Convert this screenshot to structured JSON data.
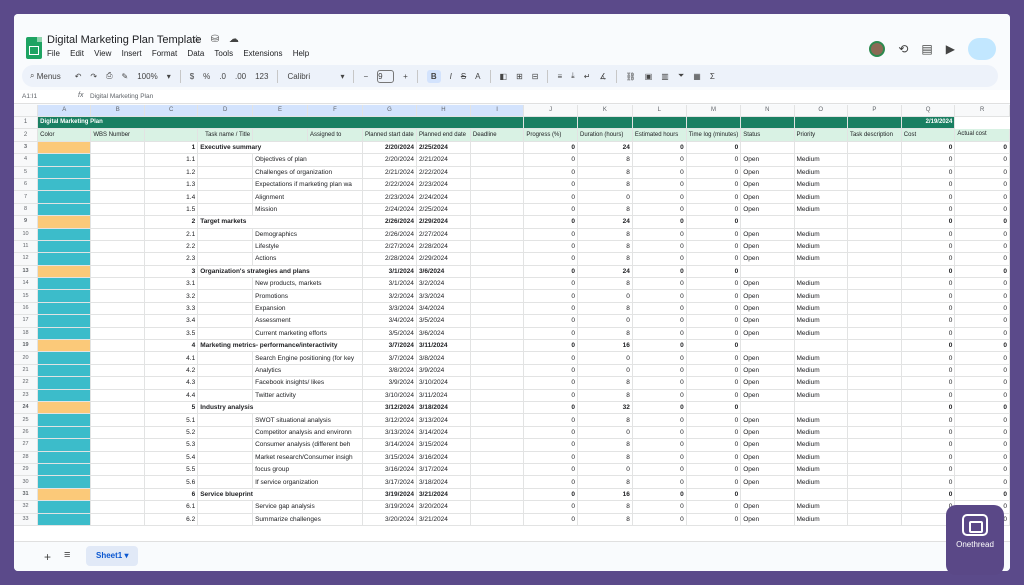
{
  "app": {
    "doc_title": "Digital Marketing Plan Template",
    "menu": [
      "File",
      "Edit",
      "View",
      "Insert",
      "Format",
      "Data",
      "Tools",
      "Extensions",
      "Help"
    ]
  },
  "toolbar": {
    "menus_label": "Menus",
    "zoom": "100%",
    "currency": "$",
    "percent": "%",
    "decrease_decimal": ".0",
    "increase_decimal": ".00",
    "number_format": "123",
    "font": "Calibri",
    "font_size": "9",
    "bold": "B",
    "italic": "I",
    "strike": "S",
    "text_color": "A"
  },
  "formula_bar": {
    "cell": "A1:I1",
    "fx": "fx",
    "content": "Digital Marketing Plan"
  },
  "columns": [
    "A",
    "B",
    "C",
    "D",
    "E",
    "F",
    "G",
    "H",
    "I",
    "J",
    "K",
    "L",
    "M",
    "N",
    "O",
    "P",
    "Q",
    "R"
  ],
  "title_row": {
    "text": "Digital Marketing Plan",
    "date": "2/19/2024"
  },
  "headers": [
    "Color",
    "WBS Number",
    "",
    "Task name / Title",
    "",
    "Assigned to",
    "Planned start date",
    "Planned end date",
    "Deadline",
    "Progress (%)",
    "Duration (hours)",
    "Estimated hours",
    "Time log (minutes)",
    "Status",
    "Priority",
    "Task description",
    "Cost",
    "Actual cost"
  ],
  "rows": [
    {
      "n": "3",
      "color": "orange",
      "section": true,
      "wbs": "1",
      "task": "Executive summary",
      "start": "2/20/2024",
      "end": "2/25/2024",
      "progress": "0",
      "duration": "24",
      "est": "0",
      "time": "0",
      "status": "",
      "priority": "",
      "cost": "0",
      "actual": "0"
    },
    {
      "n": "4",
      "color": "teal",
      "wbs": "1.1",
      "task": "Objectives of plan",
      "start": "2/20/2024",
      "end": "2/21/2024",
      "progress": "0",
      "duration": "8",
      "est": "0",
      "time": "0",
      "status": "Open",
      "priority": "Medium",
      "cost": "0",
      "actual": "0"
    },
    {
      "n": "5",
      "color": "teal",
      "wbs": "1.2",
      "task": "Challenges of organization",
      "start": "2/21/2024",
      "end": "2/22/2024",
      "progress": "0",
      "duration": "8",
      "est": "0",
      "time": "0",
      "status": "Open",
      "priority": "Medium",
      "cost": "0",
      "actual": "0"
    },
    {
      "n": "6",
      "color": "teal",
      "wbs": "1.3",
      "task": "Expectations if marketing plan wa",
      "start": "2/22/2024",
      "end": "2/23/2024",
      "progress": "0",
      "duration": "8",
      "est": "0",
      "time": "0",
      "status": "Open",
      "priority": "Medium",
      "cost": "0",
      "actual": "0"
    },
    {
      "n": "7",
      "color": "teal",
      "wbs": "1.4",
      "task": "Alignment",
      "start": "2/23/2024",
      "end": "2/24/2024",
      "progress": "0",
      "duration": "0",
      "est": "0",
      "time": "0",
      "status": "Open",
      "priority": "Medium",
      "cost": "0",
      "actual": "0"
    },
    {
      "n": "8",
      "color": "teal",
      "wbs": "1.5",
      "task": "Mission",
      "start": "2/24/2024",
      "end": "2/25/2024",
      "progress": "0",
      "duration": "8",
      "est": "0",
      "time": "0",
      "status": "Open",
      "priority": "Medium",
      "cost": "0",
      "actual": "0"
    },
    {
      "n": "9",
      "color": "orange",
      "section": true,
      "wbs": "2",
      "task": "Target markets",
      "start": "2/26/2024",
      "end": "2/29/2024",
      "progress": "0",
      "duration": "24",
      "est": "0",
      "time": "0",
      "status": "",
      "priority": "",
      "cost": "0",
      "actual": "0"
    },
    {
      "n": "10",
      "color": "teal",
      "wbs": "2.1",
      "task": "Demographics",
      "start": "2/26/2024",
      "end": "2/27/2024",
      "progress": "0",
      "duration": "8",
      "est": "0",
      "time": "0",
      "status": "Open",
      "priority": "Medium",
      "cost": "0",
      "actual": "0"
    },
    {
      "n": "11",
      "color": "teal",
      "wbs": "2.2",
      "task": "Lifestyle",
      "start": "2/27/2024",
      "end": "2/28/2024",
      "progress": "0",
      "duration": "8",
      "est": "0",
      "time": "0",
      "status": "Open",
      "priority": "Medium",
      "cost": "0",
      "actual": "0"
    },
    {
      "n": "12",
      "color": "teal",
      "wbs": "2.3",
      "task": "Actions",
      "start": "2/28/2024",
      "end": "2/29/2024",
      "progress": "0",
      "duration": "8",
      "est": "0",
      "time": "0",
      "status": "Open",
      "priority": "Medium",
      "cost": "0",
      "actual": "0"
    },
    {
      "n": "13",
      "color": "orange",
      "section": true,
      "wbs": "3",
      "task": "Organization's strategies and plans",
      "start": "3/1/2024",
      "end": "3/6/2024",
      "progress": "0",
      "duration": "24",
      "est": "0",
      "time": "0",
      "status": "",
      "priority": "",
      "cost": "0",
      "actual": "0"
    },
    {
      "n": "14",
      "color": "teal",
      "wbs": "3.1",
      "task": "New products, markets",
      "start": "3/1/2024",
      "end": "3/2/2024",
      "progress": "0",
      "duration": "8",
      "est": "0",
      "time": "0",
      "status": "Open",
      "priority": "Medium",
      "cost": "0",
      "actual": "0"
    },
    {
      "n": "15",
      "color": "teal",
      "wbs": "3.2",
      "task": "Promotions",
      "start": "3/2/2024",
      "end": "3/3/2024",
      "progress": "0",
      "duration": "0",
      "est": "0",
      "time": "0",
      "status": "Open",
      "priority": "Medium",
      "cost": "0",
      "actual": "0"
    },
    {
      "n": "16",
      "color": "teal",
      "wbs": "3.3",
      "task": "Expansion",
      "start": "3/3/2024",
      "end": "3/4/2024",
      "progress": "0",
      "duration": "8",
      "est": "0",
      "time": "0",
      "status": "Open",
      "priority": "Medium",
      "cost": "0",
      "actual": "0"
    },
    {
      "n": "17",
      "color": "teal",
      "wbs": "3.4",
      "task": "Assessment",
      "start": "3/4/2024",
      "end": "3/5/2024",
      "progress": "0",
      "duration": "0",
      "est": "0",
      "time": "0",
      "status": "Open",
      "priority": "Medium",
      "cost": "0",
      "actual": "0"
    },
    {
      "n": "18",
      "color": "teal",
      "wbs": "3.5",
      "task": "Current marketing efforts",
      "start": "3/5/2024",
      "end": "3/6/2024",
      "progress": "0",
      "duration": "8",
      "est": "0",
      "time": "0",
      "status": "Open",
      "priority": "Medium",
      "cost": "0",
      "actual": "0"
    },
    {
      "n": "19",
      "color": "orange",
      "section": true,
      "wbs": "4",
      "task": "Marketing metrics- performance/interactivity",
      "start": "3/7/2024",
      "end": "3/11/2024",
      "progress": "0",
      "duration": "16",
      "est": "0",
      "time": "0",
      "status": "",
      "priority": "",
      "cost": "0",
      "actual": "0"
    },
    {
      "n": "20",
      "color": "teal",
      "wbs": "4.1",
      "task": "Search Engine positioning (for key",
      "start": "3/7/2024",
      "end": "3/8/2024",
      "progress": "0",
      "duration": "0",
      "est": "0",
      "time": "0",
      "status": "Open",
      "priority": "Medium",
      "cost": "0",
      "actual": "0"
    },
    {
      "n": "21",
      "color": "teal",
      "wbs": "4.2",
      "task": "Analytics",
      "start": "3/8/2024",
      "end": "3/9/2024",
      "progress": "0",
      "duration": "0",
      "est": "0",
      "time": "0",
      "status": "Open",
      "priority": "Medium",
      "cost": "0",
      "actual": "0"
    },
    {
      "n": "22",
      "color": "teal",
      "wbs": "4.3",
      "task": "Facebook insights/ likes",
      "start": "3/9/2024",
      "end": "3/10/2024",
      "progress": "0",
      "duration": "8",
      "est": "0",
      "time": "0",
      "status": "Open",
      "priority": "Medium",
      "cost": "0",
      "actual": "0"
    },
    {
      "n": "23",
      "color": "teal",
      "wbs": "4.4",
      "task": "Twitter activity",
      "start": "3/10/2024",
      "end": "3/11/2024",
      "progress": "0",
      "duration": "8",
      "est": "0",
      "time": "0",
      "status": "Open",
      "priority": "Medium",
      "cost": "0",
      "actual": "0"
    },
    {
      "n": "24",
      "color": "orange",
      "section": true,
      "wbs": "5",
      "task": "Industry analysis",
      "start": "3/12/2024",
      "end": "3/18/2024",
      "progress": "0",
      "duration": "32",
      "est": "0",
      "time": "0",
      "status": "",
      "priority": "",
      "cost": "0",
      "actual": "0"
    },
    {
      "n": "25",
      "color": "teal",
      "wbs": "5.1",
      "task": "SWOT situational analysis",
      "start": "3/12/2024",
      "end": "3/13/2024",
      "progress": "0",
      "duration": "8",
      "est": "0",
      "time": "0",
      "status": "Open",
      "priority": "Medium",
      "cost": "0",
      "actual": "0"
    },
    {
      "n": "26",
      "color": "teal",
      "wbs": "5.2",
      "task": "Competitor analysis and environn",
      "start": "3/13/2024",
      "end": "3/14/2024",
      "progress": "0",
      "duration": "0",
      "est": "0",
      "time": "0",
      "status": "Open",
      "priority": "Medium",
      "cost": "0",
      "actual": "0"
    },
    {
      "n": "27",
      "color": "teal",
      "wbs": "5.3",
      "task": "Consumer analysis (different beh",
      "start": "3/14/2024",
      "end": "3/15/2024",
      "progress": "0",
      "duration": "8",
      "est": "0",
      "time": "0",
      "status": "Open",
      "priority": "Medium",
      "cost": "0",
      "actual": "0"
    },
    {
      "n": "28",
      "color": "teal",
      "wbs": "5.4",
      "task": "Market research/Consumer insigh",
      "start": "3/15/2024",
      "end": "3/16/2024",
      "progress": "0",
      "duration": "8",
      "est": "0",
      "time": "0",
      "status": "Open",
      "priority": "Medium",
      "cost": "0",
      "actual": "0"
    },
    {
      "n": "29",
      "color": "teal",
      "wbs": "5.5",
      "task": "focus group",
      "start": "3/16/2024",
      "end": "3/17/2024",
      "progress": "0",
      "duration": "0",
      "est": "0",
      "time": "0",
      "status": "Open",
      "priority": "Medium",
      "cost": "0",
      "actual": "0"
    },
    {
      "n": "30",
      "color": "teal",
      "wbs": "5.6",
      "task": "If service organization",
      "start": "3/17/2024",
      "end": "3/18/2024",
      "progress": "0",
      "duration": "8",
      "est": "0",
      "time": "0",
      "status": "Open",
      "priority": "Medium",
      "cost": "0",
      "actual": "0"
    },
    {
      "n": "31",
      "color": "orange",
      "section": true,
      "wbs": "6",
      "task": "Service blueprint",
      "start": "3/19/2024",
      "end": "3/21/2024",
      "progress": "0",
      "duration": "16",
      "est": "0",
      "time": "0",
      "status": "",
      "priority": "",
      "cost": "0",
      "actual": "0"
    },
    {
      "n": "32",
      "color": "teal",
      "wbs": "6.1",
      "task": "Service gap analysis",
      "start": "3/19/2024",
      "end": "3/20/2024",
      "progress": "0",
      "duration": "8",
      "est": "0",
      "time": "0",
      "status": "Open",
      "priority": "Medium",
      "cost": "0",
      "actual": "0"
    },
    {
      "n": "33",
      "color": "teal",
      "wbs": "6.2",
      "task": "Summarize challenges",
      "start": "3/20/2024",
      "end": "3/21/2024",
      "progress": "0",
      "duration": "8",
      "est": "0",
      "time": "0",
      "status": "Open",
      "priority": "Medium",
      "cost": "0",
      "actual": "0"
    }
  ],
  "sheet_tabs": {
    "add": "+",
    "all": "≡",
    "active": "Sheet1"
  },
  "brand": {
    "name": "Onethread"
  },
  "colors": {
    "title_bg": "#1a7f62",
    "header_bg": "#d9f2e4",
    "orange": "#fbc979",
    "teal": "#3cbcca"
  }
}
